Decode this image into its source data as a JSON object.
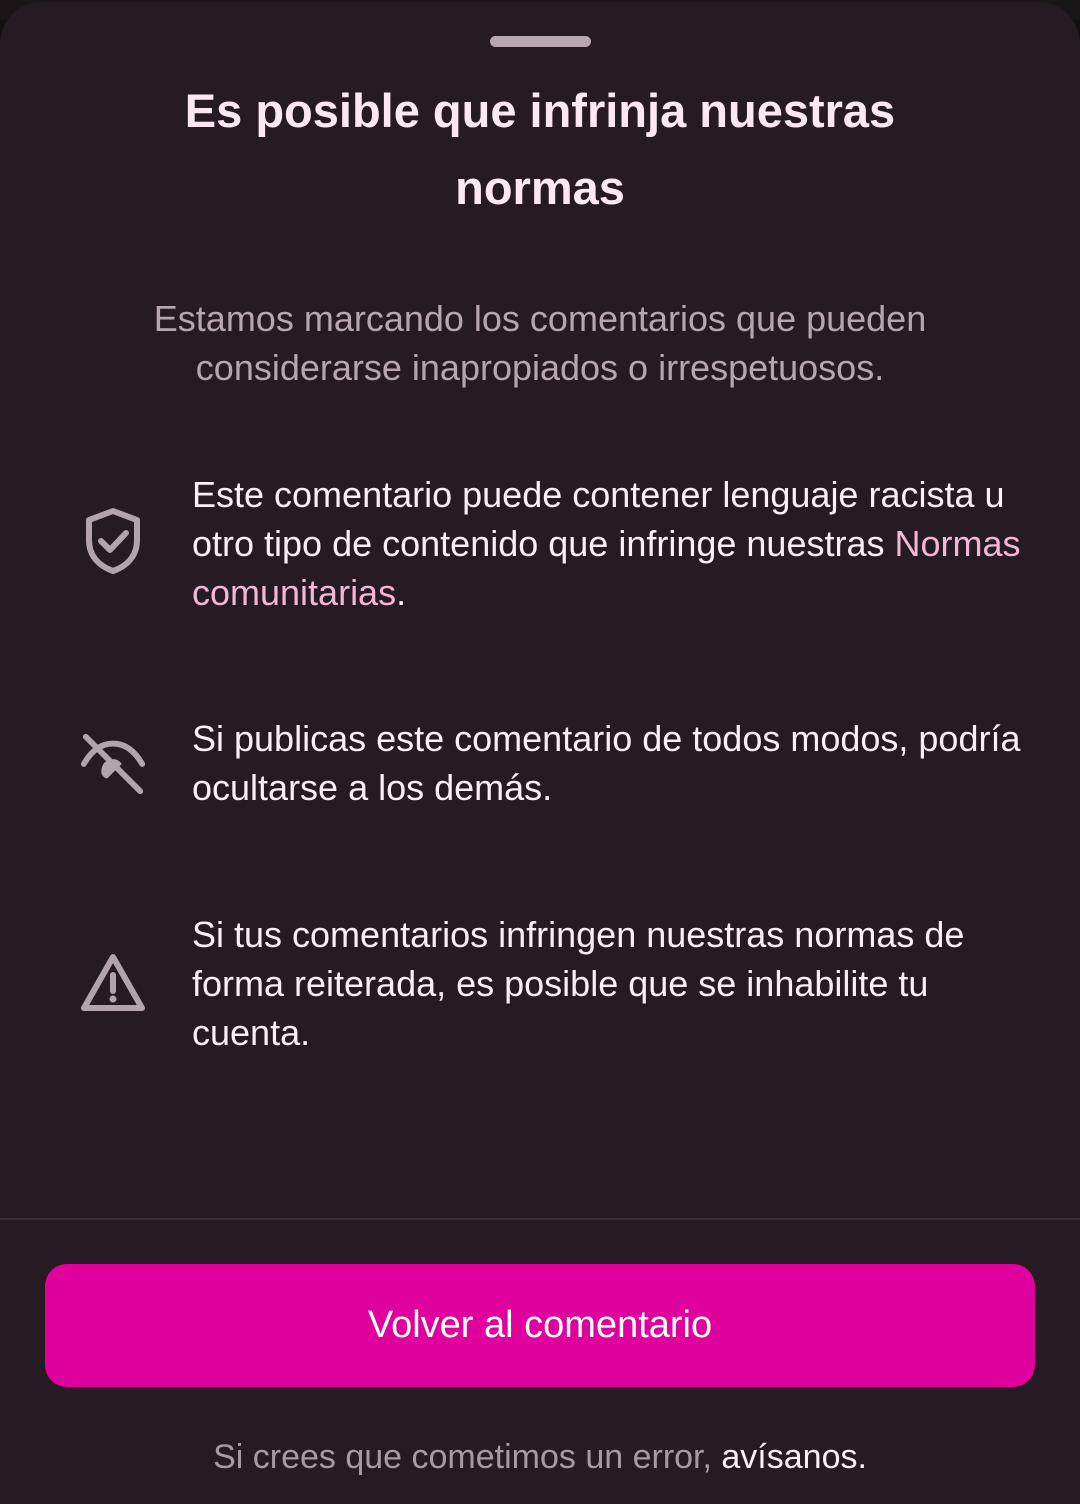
{
  "sheet": {
    "title": "Es posible que infrinja nuestras normas",
    "subtitle": "Estamos marcando los comentarios que pueden considerarse inapropiados o irrespetuosos.",
    "items": [
      {
        "icon": "shield-check-icon",
        "text_before": "Este comentario puede contener lenguaje racista u otro tipo de contenido que infringe nuestras ",
        "link": "Normas comunitarias",
        "text_after": "."
      },
      {
        "icon": "eye-off-icon",
        "text": "Si publicas este comentario de todos modos, podría ocultarse a los demás."
      },
      {
        "icon": "warning-triangle-icon",
        "text": "Si tus comentarios infringen nuestras normas de forma reiterada, es posible que se inhabilite tu cuenta."
      }
    ],
    "primary_button_label": "Volver al comentario",
    "footer_text": "Si crees que cometimos un error, ",
    "footer_link": "avísanos."
  },
  "colors": {
    "sheet_background": "#261b22",
    "accent": "#e0009e",
    "link": "#f2b7d6"
  }
}
